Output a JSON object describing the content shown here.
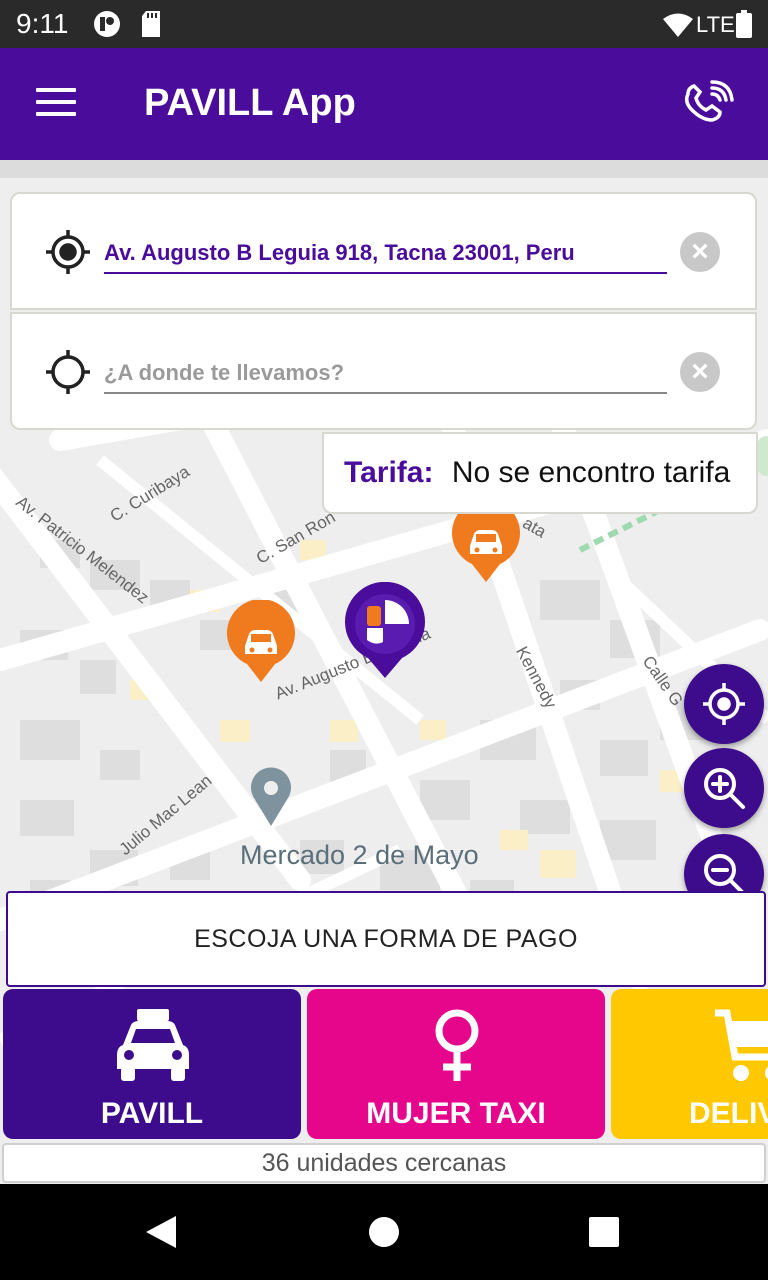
{
  "status_bar": {
    "time": "9:11",
    "network": "LTE"
  },
  "app_bar": {
    "title": "PAVILL App",
    "menu_icon": "hamburger-menu-icon",
    "call_icon": "phone-call-icon"
  },
  "route": {
    "origin": {
      "value": "Av. Augusto B Leguia 918, Tacna 23001, Peru",
      "icon": "my-location-icon"
    },
    "destination": {
      "value": "",
      "placeholder": "¿A donde te llevamos?",
      "icon": "location-target-icon"
    },
    "clear_icon": "clear-icon"
  },
  "fare": {
    "label": "Tarifa:",
    "value": "No se encontro tarifa"
  },
  "map": {
    "street_labels": [
      "Av. Patricio Melendez",
      "C. Curibaya",
      "C. San Ron",
      "Av. Augusto B. Leguia",
      "Kennedy",
      "Calle G",
      "Julio Mac Lean",
      "ata"
    ],
    "poi_label": "Mercado 2 de Mayo"
  },
  "map_controls": {
    "locate_icon": "crosshair-icon",
    "zoom_in_icon": "zoom-in-icon",
    "zoom_out_icon": "zoom-out-icon"
  },
  "payment": {
    "label": "ESCOJA UNA FORMA DE PAGO"
  },
  "services": [
    {
      "label": "PAVILL",
      "icon": "taxi-icon",
      "color": "#3d0c8c"
    },
    {
      "label": "MUJER TAXI",
      "icon": "female-symbol-icon",
      "color": "#e6068c"
    },
    {
      "label": "DELIV",
      "icon": "shopping-cart-icon",
      "color": "#ffc800"
    }
  ],
  "nearby_text": "36 unidades cercanas",
  "colors": {
    "primary": "#4a0c9a",
    "accent_pink": "#e6068c",
    "accent_yellow": "#ffc800",
    "marker_orange": "#f07a1e"
  }
}
